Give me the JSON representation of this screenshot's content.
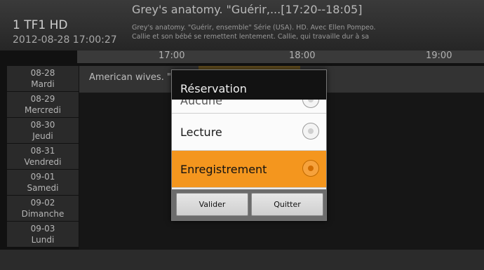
{
  "header": {
    "channel": "1 TF1 HD",
    "datetime": "2012-08-28 17:00:27",
    "program_title": "Grey's anatomy. \"Guérir,...[17:20--18:05]",
    "program_description_line1": "Grey's anatomy. \"Guérir, ensemble\" Série (USA). HD. Avec Ellen Pompeo.",
    "program_description_line2": "Callie et son bébé se remettent lentement. Callie, qui travaille dur à sa"
  },
  "timeline": {
    "t1": "17:00",
    "t2": "18:00",
    "t3": "19:00"
  },
  "days": [
    {
      "date": "08-28",
      "name": "Mardi"
    },
    {
      "date": "08-29",
      "name": "Mercredi"
    },
    {
      "date": "08-30",
      "name": "Jeudi"
    },
    {
      "date": "08-31",
      "name": "Vendredi"
    },
    {
      "date": "09-01",
      "name": "Samedi"
    },
    {
      "date": "09-02",
      "name": "Dimanche"
    },
    {
      "date": "09-03",
      "name": "Lundi"
    }
  ],
  "guide": {
    "row1_program": "American wives. \""
  },
  "dialog": {
    "title": "Réservation",
    "options": [
      "Aucune",
      "Lecture",
      "Enregistrement"
    ],
    "selected": "Enregistrement",
    "confirm_label": "Valider",
    "cancel_label": "Quitter"
  },
  "colors": {
    "accent": "#f4961e"
  }
}
